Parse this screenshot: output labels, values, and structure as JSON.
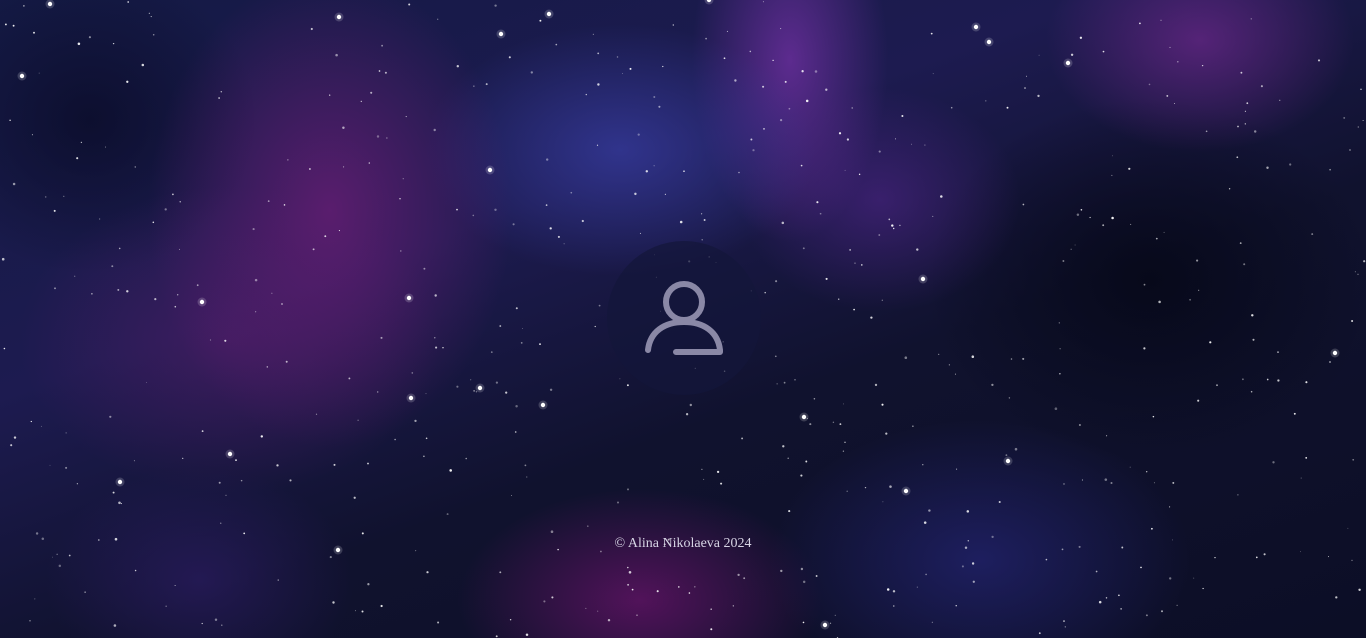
{
  "background": {
    "description_icon": "starfield-nebula",
    "colors": {
      "base": "#0b0d24",
      "nebula_purple": "#6e1e78",
      "nebula_blue": "#373ca0",
      "star": "#ffffff"
    }
  },
  "user": {
    "avatar_icon": "user-icon",
    "icon_color": "#8a88a6"
  },
  "footer": {
    "copyright": "© Alina Nikolaeva 2024"
  }
}
